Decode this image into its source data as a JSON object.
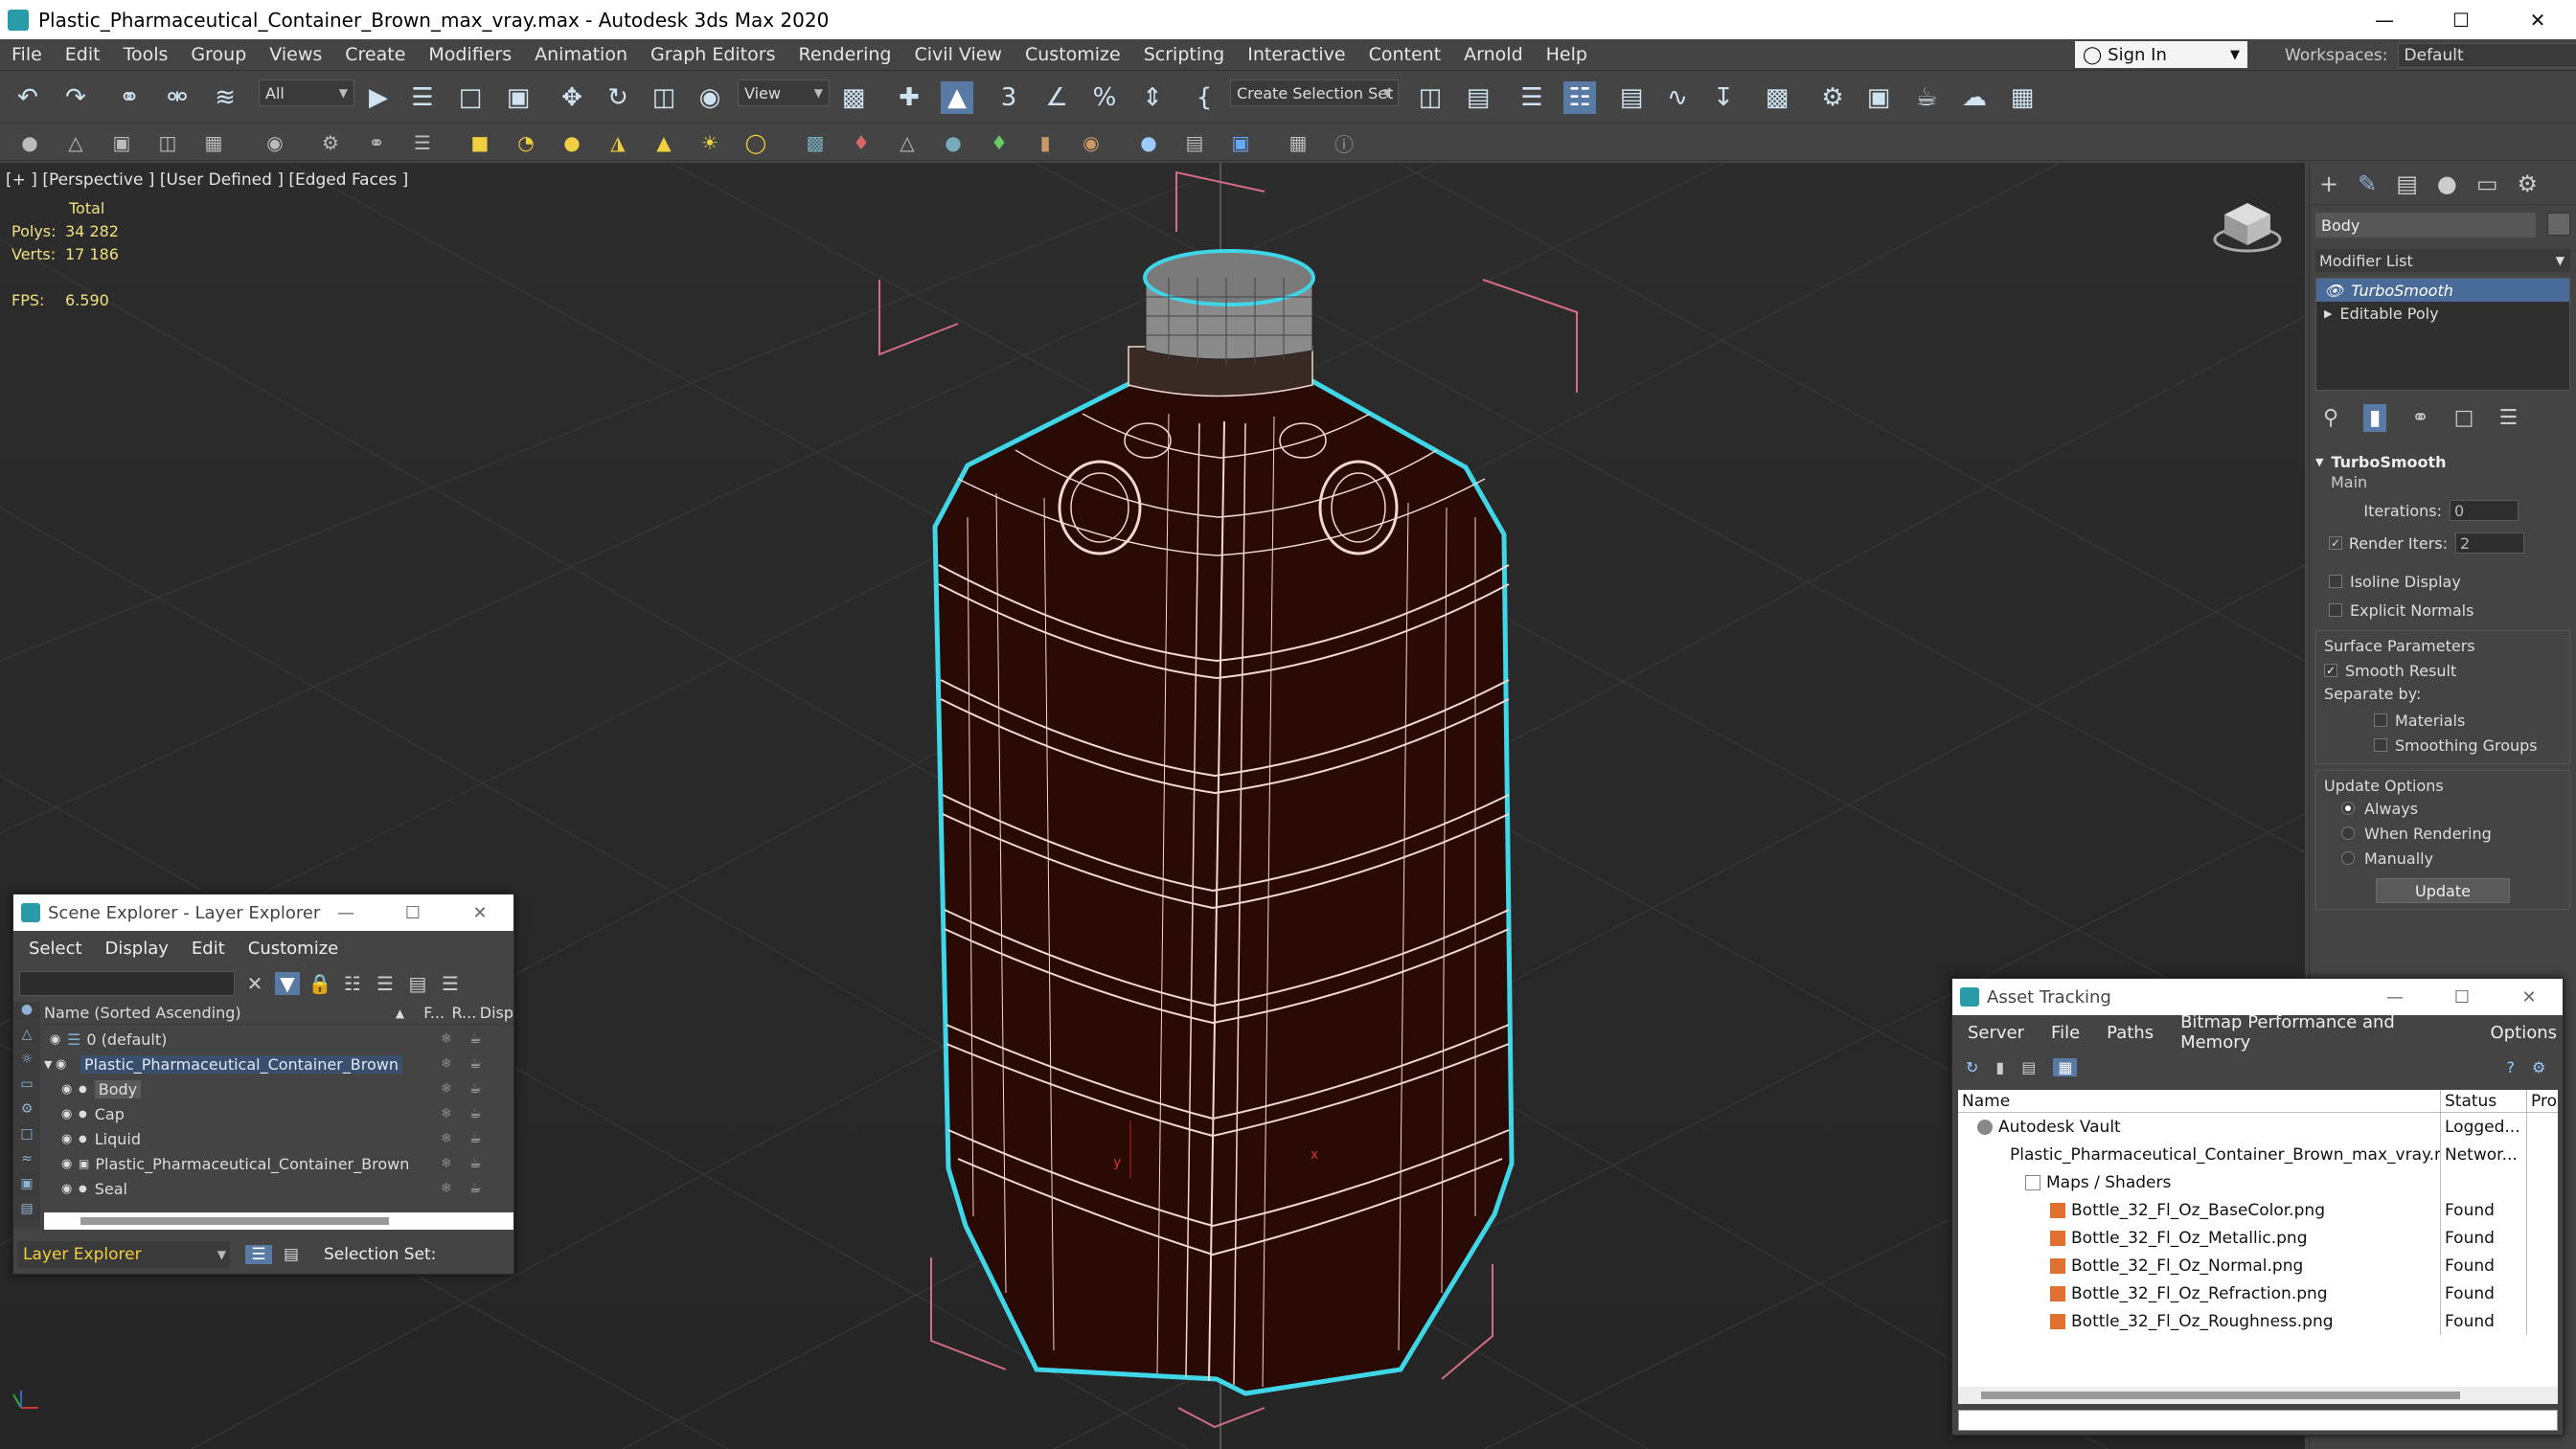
{
  "window": {
    "title": "Plastic_Pharmaceutical_Container_Brown_max_vray.max - Autodesk 3ds Max 2020",
    "minimize": "—",
    "maximize": "☐",
    "close": "✕"
  },
  "menu": [
    "File",
    "Edit",
    "Tools",
    "Group",
    "Views",
    "Create",
    "Modifiers",
    "Animation",
    "Graph Editors",
    "Rendering",
    "Civil View",
    "Customize",
    "Scripting",
    "Interactive",
    "Content",
    "Arnold",
    "Help"
  ],
  "account": {
    "sign_in": "Sign In",
    "workspaces_label": "Workspaces:",
    "workspace": "Default"
  },
  "toolbar": {
    "selection_filter": "All",
    "ref_coord": "View",
    "selection_set": "Create Selection Set"
  },
  "viewport": {
    "label": "[+ ] [Perspective ] [User Defined ] [Edged Faces ]",
    "stats_header": "Total",
    "polys_label": "Polys:",
    "polys": "34 282",
    "verts_label": "Verts:",
    "verts": "17 186",
    "fps_label": "FPS:",
    "fps": "6.590"
  },
  "command_panel": {
    "object_name": "Body",
    "modifier_list": "Modifier List",
    "stack": [
      "TurboSmooth",
      "Editable Poly"
    ],
    "rollout_title": "TurboSmooth",
    "main_label": "Main",
    "iterations_label": "Iterations:",
    "iterations": "0",
    "render_iters_label": "Render Iters:",
    "render_iters": "2",
    "isoline": "Isoline Display",
    "explicit_normals": "Explicit Normals",
    "surface_params": "Surface Parameters",
    "smooth_result": "Smooth Result",
    "separate_by": "Separate by:",
    "materials": "Materials",
    "smoothing_groups": "Smoothing Groups",
    "update_options": "Update Options",
    "always": "Always",
    "when_rendering": "When Rendering",
    "manually": "Manually",
    "update_button": "Update"
  },
  "scene_explorer": {
    "title": "Scene Explorer - Layer Explorer",
    "menus": [
      "Select",
      "Display",
      "Edit",
      "Customize"
    ],
    "col_name": "Name (Sorted Ascending)",
    "col_f": "F...",
    "col_r": "R...",
    "col_disp": "Disp",
    "rows": [
      {
        "name": "0 (default)",
        "indent": 0
      },
      {
        "name": "Plastic_Pharmaceutical_Container_Brown",
        "indent": 0
      },
      {
        "name": "Body",
        "indent": 1
      },
      {
        "name": "Cap",
        "indent": 1
      },
      {
        "name": "Liquid",
        "indent": 1
      },
      {
        "name": "Plastic_Pharmaceutical_Container_Brown",
        "indent": 1
      },
      {
        "name": "Seal",
        "indent": 1
      }
    ],
    "footer_layer": "Layer Explorer",
    "selection_set_label": "Selection Set:"
  },
  "asset_tracking": {
    "title": "Asset Tracking",
    "menus": [
      "Server",
      "File",
      "Paths",
      "Bitmap Performance and Memory",
      "Options"
    ],
    "col_name": "Name",
    "col_status": "Status",
    "col_pro": "Pro",
    "rows": [
      {
        "name": "Autodesk Vault",
        "status": "Logged..."
      },
      {
        "name": "Plastic_Pharmaceutical_Container_Brown_max_vray.max",
        "status": "Networ..."
      },
      {
        "name": "Maps / Shaders",
        "status": ""
      },
      {
        "name": "Bottle_32_Fl_Oz_BaseColor.png",
        "status": "Found"
      },
      {
        "name": "Bottle_32_Fl_Oz_Metallic.png",
        "status": "Found"
      },
      {
        "name": "Bottle_32_Fl_Oz_Normal.png",
        "status": "Found"
      },
      {
        "name": "Bottle_32_Fl_Oz_Refraction.png",
        "status": "Found"
      },
      {
        "name": "Bottle_32_Fl_Oz_Roughness.png",
        "status": "Found"
      }
    ]
  },
  "colors": {
    "accent": "#5a7aa6",
    "selection_outline": "#3fd6e8",
    "bottle": "#2a0a05",
    "wire": "#f2d8d0"
  }
}
